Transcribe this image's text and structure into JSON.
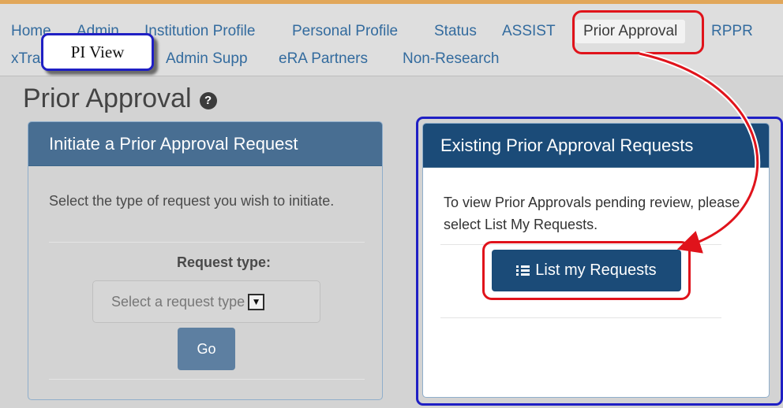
{
  "nav": {
    "items": [
      "Home",
      "Admin",
      "Institution Profile",
      "Personal Profile",
      "Status",
      "ASSIST",
      "Prior Approval",
      "RPPR",
      "xTrain",
      "Admin Supp",
      "eRA Partners",
      "Non-Research"
    ],
    "active": "Prior Approval"
  },
  "callout": {
    "label": "PI View"
  },
  "page": {
    "title": "Prior Approval"
  },
  "initiate_panel": {
    "heading": "Initiate a Prior Approval Request",
    "instructions": "Select the type of request you wish to initiate.",
    "request_type_label": "Request type:",
    "select_placeholder": "Select a request type",
    "go_label": "Go"
  },
  "existing_panel": {
    "heading": "Existing Prior Approval Requests",
    "instructions": "To view Prior Approvals pending review, please select List My Requests.",
    "button_label": "List my Requests"
  },
  "colors": {
    "accent_stripe": "#e1a75a",
    "nav_link": "#336b9e",
    "annotation_red": "#e0131b",
    "annotation_blue": "#1f1fc4",
    "panel_header_left": "#486e92",
    "panel_header_right": "#1b4b78"
  }
}
